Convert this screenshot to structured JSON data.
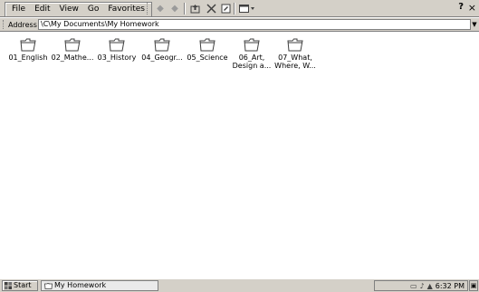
{
  "menu": {
    "file": "File",
    "edit": "Edit",
    "view": "View",
    "go": "Go",
    "favorites": "Favorites"
  },
  "toolbar": {
    "back_icon": "back-arrow-icon",
    "forward_icon": "forward-arrow-icon",
    "up_icon": "up-folder-icon",
    "delete_icon": "delete-x-icon",
    "properties_icon": "properties-icon",
    "views_icon": "views-dropdown-icon",
    "help_glyph": "?",
    "close_glyph": "×"
  },
  "address": {
    "label": "Address",
    "value": "\\C\\My Documents\\My Homework"
  },
  "folders": [
    {
      "label": "01_English"
    },
    {
      "label": "02_Mathe..."
    },
    {
      "label": "03_History"
    },
    {
      "label": "04_Geogr..."
    },
    {
      "label": "05_Science"
    },
    {
      "label": "06_Art,\nDesign a..."
    },
    {
      "label": "07_What,\nWhere, W..."
    }
  ],
  "taskbar": {
    "start_label": "Start",
    "task_label": "My Homework",
    "time": "6:32 PM"
  }
}
